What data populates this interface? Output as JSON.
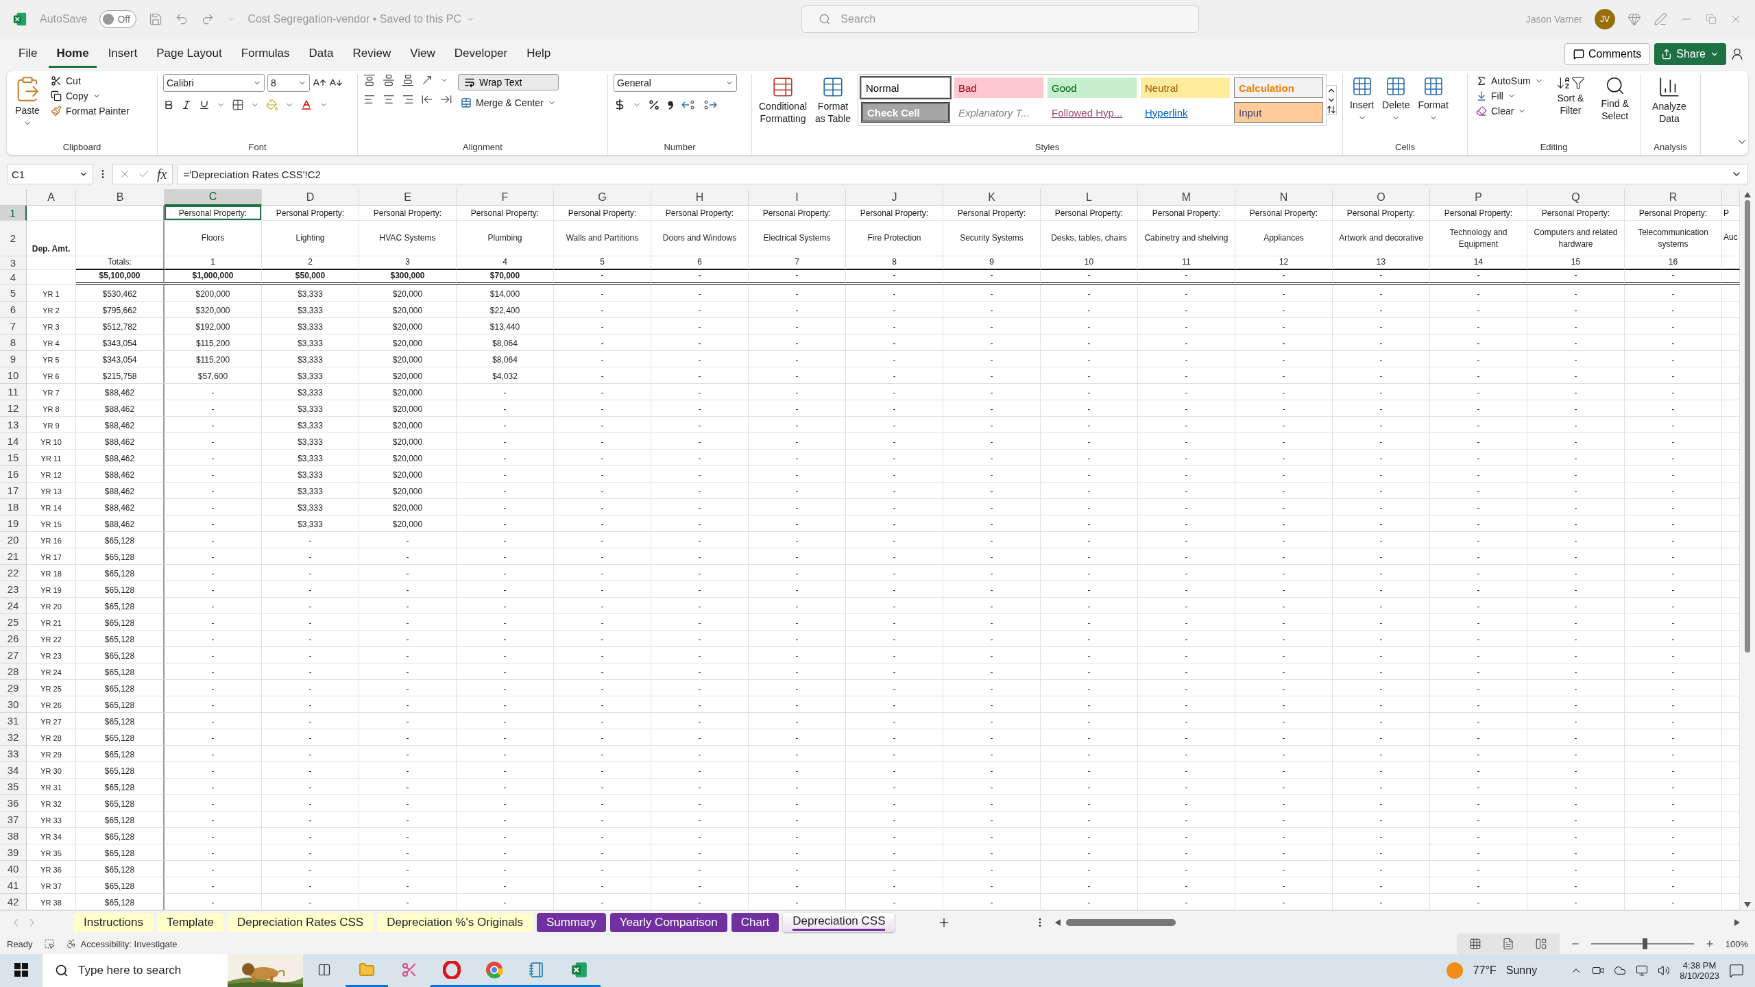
{
  "title_bar": {
    "autosave_label": "AutoSave",
    "autosave_on": false,
    "autosave_state": "Off",
    "document": "Cost Segregation-vendor • Saved to this PC",
    "search_placeholder": "Search",
    "user": "Jason Varner",
    "initials": "JV"
  },
  "menu_tabs": [
    {
      "label": "File",
      "selected": false
    },
    {
      "label": "Home",
      "selected": true
    },
    {
      "label": "Insert",
      "selected": false
    },
    {
      "label": "Page Layout",
      "selected": false
    },
    {
      "label": "Formulas",
      "selected": false
    },
    {
      "label": "Data",
      "selected": false
    },
    {
      "label": "Review",
      "selected": false
    },
    {
      "label": "View",
      "selected": false
    },
    {
      "label": "Developer",
      "selected": false
    },
    {
      "label": "Help",
      "selected": false
    }
  ],
  "comments": "Comments",
  "share": "Share",
  "ribbon": {
    "clipboard": {
      "paste": "Paste",
      "cut": "Cut",
      "copy": "Copy",
      "format_painter": "Format Painter",
      "label": "Clipboard"
    },
    "font": {
      "name": "Calibri",
      "size": "8",
      "label": "Font"
    },
    "alignment": {
      "wrap_text": "Wrap Text",
      "merge": "Merge & Center",
      "label": "Alignment"
    },
    "number": {
      "format": "General",
      "label": "Number"
    },
    "styles": {
      "conditional": "Conditional Formatting",
      "format_table": "Format as Table",
      "label": "Styles",
      "gallery": [
        {
          "label": "Normal",
          "kind": "normal",
          "selected": true
        },
        {
          "label": "Bad",
          "kind": "bad",
          "selected": false
        },
        {
          "label": "Good",
          "kind": "good",
          "selected": false
        },
        {
          "label": "Neutral",
          "kind": "neutral",
          "selected": false
        },
        {
          "label": "Calculation",
          "kind": "calculation",
          "selected": false
        },
        {
          "label": "Check Cell",
          "kind": "check",
          "selected": false
        },
        {
          "label": "Explanatory T...",
          "kind": "explanatory",
          "selected": false
        },
        {
          "label": "Followed Hyp...",
          "kind": "followed",
          "selected": false
        },
        {
          "label": "Hyperlink",
          "kind": "hyperlink",
          "selected": false
        },
        {
          "label": "Input",
          "kind": "input",
          "selected": false
        }
      ]
    },
    "cells": {
      "buttons": [
        "Insert",
        "Delete",
        "Format"
      ],
      "label": "Cells"
    },
    "editing": {
      "autosum": "AutoSum",
      "fill": "Fill",
      "clear": "Clear",
      "sort": "Sort & Filter",
      "find": "Find & Select",
      "label": "Editing"
    },
    "analysis": {
      "analyze": "Analyze Data",
      "label": "Analysis"
    }
  },
  "formula_bar": {
    "name_box": "C1",
    "fx": "fx",
    "formula": "='Depreciation Rates CSS'!C2"
  },
  "grid": {
    "columns": [
      {
        "letter": "A",
        "selected": false
      },
      {
        "letter": "B",
        "selected": false
      },
      {
        "letter": "C",
        "selected": true
      },
      {
        "letter": "D",
        "selected": false
      },
      {
        "letter": "E",
        "selected": false
      },
      {
        "letter": "F",
        "selected": false
      },
      {
        "letter": "G",
        "selected": false
      },
      {
        "letter": "H",
        "selected": false
      },
      {
        "letter": "I",
        "selected": false
      },
      {
        "letter": "J",
        "selected": false
      },
      {
        "letter": "K",
        "selected": false
      },
      {
        "letter": "L",
        "selected": false
      },
      {
        "letter": "M",
        "selected": false
      },
      {
        "letter": "N",
        "selected": false
      },
      {
        "letter": "O",
        "selected": false
      },
      {
        "letter": "P",
        "selected": false
      },
      {
        "letter": "Q",
        "selected": false
      },
      {
        "letter": "R",
        "selected": false
      }
    ],
    "rows": [
      {
        "number": "1",
        "selected": true,
        "kind": "label",
        "cells": [
          null,
          null,
          "Personal Property:",
          "Personal Property:",
          "Personal Property:",
          "Personal Property:",
          "Personal Property:",
          "Personal Property:",
          "Personal Property:",
          "Personal Property:",
          "Personal Property:",
          "Personal Property:",
          "Personal Property:",
          "Personal Property:",
          "Personal Property:",
          "Personal Property:",
          "Personal Property:",
          "Personal Property:",
          "P"
        ]
      },
      {
        "number": "2",
        "selected": false,
        "kind": "header",
        "cells": [
          "Dep. Amt.",
          null,
          "Floors",
          "Lighting",
          "HVAC Systems",
          "Plumbing",
          "Walls and Partitions",
          "Doors and Windows",
          "Electrical Systems",
          "Fire Protection",
          "Security Systems",
          "Desks, tables, chairs",
          "Cabinetry and shelving",
          "Appliances",
          "Artwork and decorative",
          "Technology and Equipment",
          "Computers and related hardware",
          "Telecommunication systems",
          "Auc"
        ]
      },
      {
        "number": "3",
        "selected": false,
        "kind": "index",
        "cells": [
          null,
          "Totals:",
          "1",
          "2",
          "3",
          "4",
          "5",
          "6",
          "7",
          "8",
          "9",
          "10",
          "11",
          "12",
          "13",
          "14",
          "15",
          "16",
          null
        ]
      },
      {
        "number": "4",
        "selected": false,
        "kind": "total",
        "cells": [
          null,
          "$5,100,000",
          "$1,000,000",
          "$50,000",
          "$300,000",
          "$70,000",
          "-",
          "-",
          "-",
          "-",
          "-",
          "-",
          "-",
          "-",
          "-",
          "-",
          "-",
          "-",
          null
        ]
      },
      {
        "number": "5",
        "selected": false,
        "kind": "year",
        "cells": [
          "YR 1",
          "$530,462",
          "$200,000",
          "$3,333",
          "$20,000",
          "$14,000",
          "-",
          "-",
          "-",
          "-",
          "-",
          "-",
          "-",
          "-",
          "-",
          "-",
          "-",
          "-",
          null
        ]
      },
      {
        "number": "6",
        "selected": false,
        "kind": "year",
        "cells": [
          "YR 2",
          "$795,662",
          "$320,000",
          "$3,333",
          "$20,000",
          "$22,400",
          "-",
          "-",
          "-",
          "-",
          "-",
          "-",
          "-",
          "-",
          "-",
          "-",
          "-",
          "-",
          null
        ]
      },
      {
        "number": "7",
        "selected": false,
        "kind": "year",
        "cells": [
          "YR 3",
          "$512,782",
          "$192,000",
          "$3,333",
          "$20,000",
          "$13,440",
          "-",
          "-",
          "-",
          "-",
          "-",
          "-",
          "-",
          "-",
          "-",
          "-",
          "-",
          "-",
          null
        ]
      },
      {
        "number": "8",
        "selected": false,
        "kind": "year",
        "cells": [
          "YR 4",
          "$343,054",
          "$115,200",
          "$3,333",
          "$20,000",
          "$8,064",
          "-",
          "-",
          "-",
          "-",
          "-",
          "-",
          "-",
          "-",
          "-",
          "-",
          "-",
          "-",
          null
        ]
      },
      {
        "number": "9",
        "selected": false,
        "kind": "year",
        "cells": [
          "YR 5",
          "$343,054",
          "$115,200",
          "$3,333",
          "$20,000",
          "$8,064",
          "-",
          "-",
          "-",
          "-",
          "-",
          "-",
          "-",
          "-",
          "-",
          "-",
          "-",
          "-",
          null
        ]
      },
      {
        "number": "10",
        "selected": false,
        "kind": "year",
        "cells": [
          "YR 6",
          "$215,758",
          "$57,600",
          "$3,333",
          "$20,000",
          "$4,032",
          "-",
          "-",
          "-",
          "-",
          "-",
          "-",
          "-",
          "-",
          "-",
          "-",
          "-",
          "-",
          null
        ]
      },
      {
        "number": "11",
        "selected": false,
        "kind": "year",
        "cells": [
          "YR 7",
          "$88,462",
          "-",
          "$3,333",
          "$20,000",
          "-",
          "-",
          "-",
          "-",
          "-",
          "-",
          "-",
          "-",
          "-",
          "-",
          "-",
          "-",
          "-",
          null
        ]
      },
      {
        "number": "12",
        "selected": false,
        "kind": "year",
        "cells": [
          "YR 8",
          "$88,462",
          "-",
          "$3,333",
          "$20,000",
          "-",
          "-",
          "-",
          "-",
          "-",
          "-",
          "-",
          "-",
          "-",
          "-",
          "-",
          "-",
          "-",
          null
        ]
      },
      {
        "number": "13",
        "selected": false,
        "kind": "year",
        "cells": [
          "YR 9",
          "$88,462",
          "-",
          "$3,333",
          "$20,000",
          "-",
          "-",
          "-",
          "-",
          "-",
          "-",
          "-",
          "-",
          "-",
          "-",
          "-",
          "-",
          "-",
          null
        ]
      },
      {
        "number": "14",
        "selected": false,
        "kind": "year",
        "cells": [
          "YR 10",
          "$88,462",
          "-",
          "$3,333",
          "$20,000",
          "-",
          "-",
          "-",
          "-",
          "-",
          "-",
          "-",
          "-",
          "-",
          "-",
          "-",
          "-",
          "-",
          null
        ]
      },
      {
        "number": "15",
        "selected": false,
        "kind": "year",
        "cells": [
          "YR 11",
          "$88,462",
          "-",
          "$3,333",
          "$20,000",
          "-",
          "-",
          "-",
          "-",
          "-",
          "-",
          "-",
          "-",
          "-",
          "-",
          "-",
          "-",
          "-",
          null
        ]
      },
      {
        "number": "16",
        "selected": false,
        "kind": "year",
        "cells": [
          "YR 12",
          "$88,462",
          "-",
          "$3,333",
          "$20,000",
          "-",
          "-",
          "-",
          "-",
          "-",
          "-",
          "-",
          "-",
          "-",
          "-",
          "-",
          "-",
          "-",
          null
        ]
      },
      {
        "number": "17",
        "selected": false,
        "kind": "year",
        "cells": [
          "YR 13",
          "$88,462",
          "-",
          "$3,333",
          "$20,000",
          "-",
          "-",
          "-",
          "-",
          "-",
          "-",
          "-",
          "-",
          "-",
          "-",
          "-",
          "-",
          "-",
          null
        ]
      },
      {
        "number": "18",
        "selected": false,
        "kind": "year",
        "cells": [
          "YR 14",
          "$88,462",
          "-",
          "$3,333",
          "$20,000",
          "-",
          "-",
          "-",
          "-",
          "-",
          "-",
          "-",
          "-",
          "-",
          "-",
          "-",
          "-",
          "-",
          null
        ]
      },
      {
        "number": "19",
        "selected": false,
        "kind": "year",
        "cells": [
          "YR 15",
          "$88,462",
          "-",
          "$3,333",
          "$20,000",
          "-",
          "-",
          "-",
          "-",
          "-",
          "-",
          "-",
          "-",
          "-",
          "-",
          "-",
          "-",
          "-",
          null
        ]
      },
      {
        "number": "20",
        "selected": false,
        "kind": "year",
        "cells": [
          "YR 16",
          "$65,128",
          "-",
          "-",
          "-",
          "-",
          "-",
          "-",
          "-",
          "-",
          "-",
          "-",
          "-",
          "-",
          "-",
          "-",
          "-",
          "-",
          null
        ]
      },
      {
        "number": "21",
        "selected": false,
        "kind": "year",
        "cells": [
          "YR 17",
          "$65,128",
          "-",
          "-",
          "-",
          "-",
          "-",
          "-",
          "-",
          "-",
          "-",
          "-",
          "-",
          "-",
          "-",
          "-",
          "-",
          "-",
          null
        ]
      },
      {
        "number": "22",
        "selected": false,
        "kind": "year",
        "cells": [
          "YR 18",
          "$65,128",
          "-",
          "-",
          "-",
          "-",
          "-",
          "-",
          "-",
          "-",
          "-",
          "-",
          "-",
          "-",
          "-",
          "-",
          "-",
          "-",
          null
        ]
      },
      {
        "number": "23",
        "selected": false,
        "kind": "year",
        "cells": [
          "YR 19",
          "$65,128",
          "-",
          "-",
          "-",
          "-",
          "-",
          "-",
          "-",
          "-",
          "-",
          "-",
          "-",
          "-",
          "-",
          "-",
          "-",
          "-",
          null
        ]
      },
      {
        "number": "24",
        "selected": false,
        "kind": "year",
        "cells": [
          "YR 20",
          "$65,128",
          "-",
          "-",
          "-",
          "-",
          "-",
          "-",
          "-",
          "-",
          "-",
          "-",
          "-",
          "-",
          "-",
          "-",
          "-",
          "-",
          null
        ]
      },
      {
        "number": "25",
        "selected": false,
        "kind": "year",
        "cells": [
          "YR 21",
          "$65,128",
          "-",
          "-",
          "-",
          "-",
          "-",
          "-",
          "-",
          "-",
          "-",
          "-",
          "-",
          "-",
          "-",
          "-",
          "-",
          "-",
          null
        ]
      },
      {
        "number": "26",
        "selected": false,
        "kind": "year",
        "cells": [
          "YR 22",
          "$65,128",
          "-",
          "-",
          "-",
          "-",
          "-",
          "-",
          "-",
          "-",
          "-",
          "-",
          "-",
          "-",
          "-",
          "-",
          "-",
          "-",
          null
        ]
      },
      {
        "number": "27",
        "selected": false,
        "kind": "year",
        "cells": [
          "YR 23",
          "$65,128",
          "-",
          "-",
          "-",
          "-",
          "-",
          "-",
          "-",
          "-",
          "-",
          "-",
          "-",
          "-",
          "-",
          "-",
          "-",
          "-",
          null
        ]
      },
      {
        "number": "28",
        "selected": false,
        "kind": "year",
        "cells": [
          "YR 24",
          "$65,128",
          "-",
          "-",
          "-",
          "-",
          "-",
          "-",
          "-",
          "-",
          "-",
          "-",
          "-",
          "-",
          "-",
          "-",
          "-",
          "-",
          null
        ]
      },
      {
        "number": "29",
        "selected": false,
        "kind": "year",
        "cells": [
          "YR 25",
          "$65,128",
          "-",
          "-",
          "-",
          "-",
          "-",
          "-",
          "-",
          "-",
          "-",
          "-",
          "-",
          "-",
          "-",
          "-",
          "-",
          "-",
          null
        ]
      },
      {
        "number": "30",
        "selected": false,
        "kind": "year",
        "cells": [
          "YR 26",
          "$65,128",
          "-",
          "-",
          "-",
          "-",
          "-",
          "-",
          "-",
          "-",
          "-",
          "-",
          "-",
          "-",
          "-",
          "-",
          "-",
          "-",
          null
        ]
      },
      {
        "number": "31",
        "selected": false,
        "kind": "year",
        "cells": [
          "YR 27",
          "$65,128",
          "-",
          "-",
          "-",
          "-",
          "-",
          "-",
          "-",
          "-",
          "-",
          "-",
          "-",
          "-",
          "-",
          "-",
          "-",
          "-",
          null
        ]
      },
      {
        "number": "32",
        "selected": false,
        "kind": "year",
        "cells": [
          "YR 28",
          "$65,128",
          "-",
          "-",
          "-",
          "-",
          "-",
          "-",
          "-",
          "-",
          "-",
          "-",
          "-",
          "-",
          "-",
          "-",
          "-",
          "-",
          null
        ]
      },
      {
        "number": "33",
        "selected": false,
        "kind": "year",
        "cells": [
          "YR 29",
          "$65,128",
          "-",
          "-",
          "-",
          "-",
          "-",
          "-",
          "-",
          "-",
          "-",
          "-",
          "-",
          "-",
          "-",
          "-",
          "-",
          "-",
          null
        ]
      },
      {
        "number": "34",
        "selected": false,
        "kind": "year",
        "cells": [
          "YR 30",
          "$65,128",
          "-",
          "-",
          "-",
          "-",
          "-",
          "-",
          "-",
          "-",
          "-",
          "-",
          "-",
          "-",
          "-",
          "-",
          "-",
          "-",
          null
        ]
      },
      {
        "number": "35",
        "selected": false,
        "kind": "year",
        "cells": [
          "YR 31",
          "$65,128",
          "-",
          "-",
          "-",
          "-",
          "-",
          "-",
          "-",
          "-",
          "-",
          "-",
          "-",
          "-",
          "-",
          "-",
          "-",
          "-",
          null
        ]
      },
      {
        "number": "36",
        "selected": false,
        "kind": "year",
        "cells": [
          "YR 32",
          "$65,128",
          "-",
          "-",
          "-",
          "-",
          "-",
          "-",
          "-",
          "-",
          "-",
          "-",
          "-",
          "-",
          "-",
          "-",
          "-",
          "-",
          null
        ]
      },
      {
        "number": "37",
        "selected": false,
        "kind": "year",
        "cells": [
          "YR 33",
          "$65,128",
          "-",
          "-",
          "-",
          "-",
          "-",
          "-",
          "-",
          "-",
          "-",
          "-",
          "-",
          "-",
          "-",
          "-",
          "-",
          "-",
          null
        ]
      },
      {
        "number": "38",
        "selected": false,
        "kind": "year",
        "cells": [
          "YR 34",
          "$65,128",
          "-",
          "-",
          "-",
          "-",
          "-",
          "-",
          "-",
          "-",
          "-",
          "-",
          "-",
          "-",
          "-",
          "-",
          "-",
          "-",
          null
        ]
      },
      {
        "number": "39",
        "selected": false,
        "kind": "year",
        "cells": [
          "YR 35",
          "$65,128",
          "-",
          "-",
          "-",
          "-",
          "-",
          "-",
          "-",
          "-",
          "-",
          "-",
          "-",
          "-",
          "-",
          "-",
          "-",
          "-",
          null
        ]
      },
      {
        "number": "40",
        "selected": false,
        "kind": "year",
        "cells": [
          "YR 36",
          "$65,128",
          "-",
          "-",
          "-",
          "-",
          "-",
          "-",
          "-",
          "-",
          "-",
          "-",
          "-",
          "-",
          "-",
          "-",
          "-",
          "-",
          null
        ]
      },
      {
        "number": "41",
        "selected": false,
        "kind": "year",
        "cells": [
          "YR 37",
          "$65,128",
          "-",
          "-",
          "-",
          "-",
          "-",
          "-",
          "-",
          "-",
          "-",
          "-",
          "-",
          "-",
          "-",
          "-",
          "-",
          "-",
          null
        ]
      },
      {
        "number": "42",
        "selected": false,
        "kind": "year",
        "cells": [
          "YR 38",
          "$65,128",
          "-",
          "-",
          "-",
          "-",
          "-",
          "-",
          "-",
          "-",
          "-",
          "-",
          "-",
          "-",
          "-",
          "-",
          "-",
          "-",
          null
        ]
      }
    ]
  },
  "sheet_tabs": [
    {
      "label": "Instructions",
      "color": "#ffffcc",
      "selected": false
    },
    {
      "label": "Template",
      "color": "#ffffcc",
      "selected": false
    },
    {
      "label": "Depreciation Rates CSS",
      "color": "#ffffcc",
      "selected": false
    },
    {
      "label": "Depreciation %'s Originals",
      "color": "#ffffcc",
      "selected": false
    },
    {
      "label": "Summary",
      "color": "#7030a0",
      "selected": false
    },
    {
      "label": "Yearly Comparison",
      "color": "#7030a0",
      "selected": false
    },
    {
      "label": "Chart",
      "color": "#7030a0",
      "selected": false
    },
    {
      "label": "Depreciation CSS",
      "color": "#7030a0",
      "selected": true
    }
  ],
  "status_bar": {
    "mode": "Ready",
    "accessibility": "Accessibility: Investigate",
    "zoom": {
      "level": 0.52,
      "label": "100%"
    }
  },
  "taskbar": {
    "search_placeholder": "Type here to search",
    "temperature": "77°F",
    "condition": "Sunny",
    "time": "4:38 PM",
    "date": "8/10/2023"
  }
}
